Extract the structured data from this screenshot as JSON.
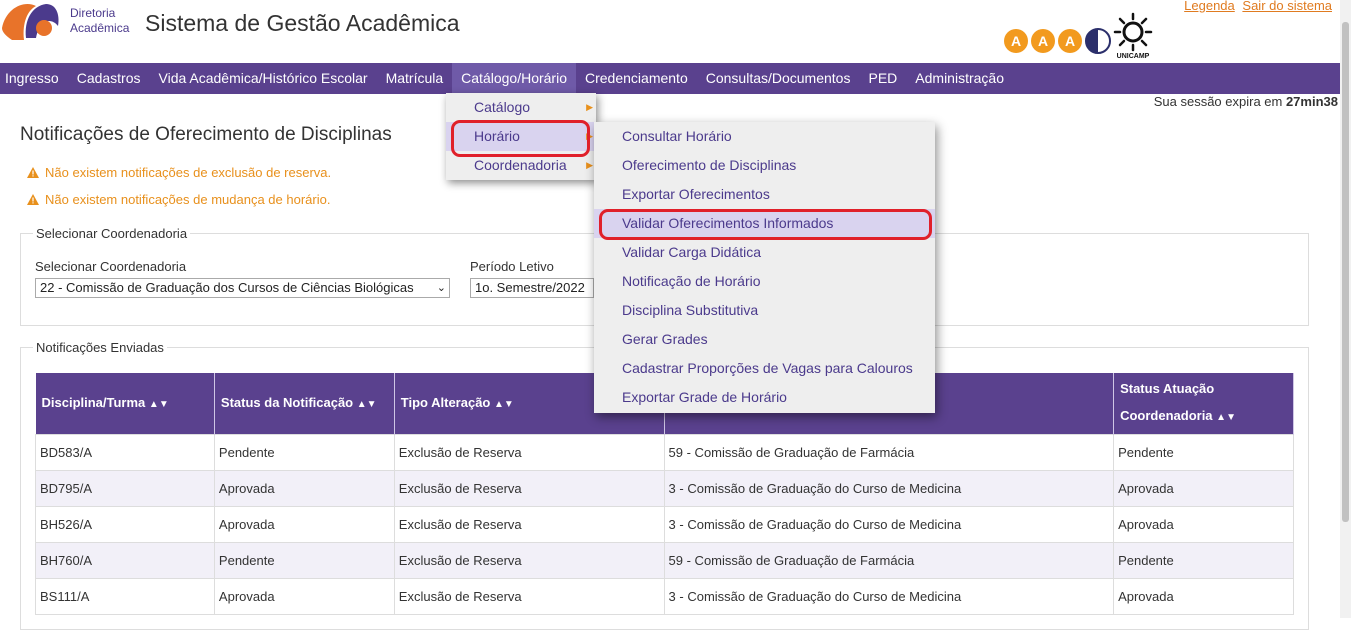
{
  "header": {
    "dir_line1": "Diretoria",
    "dir_line2": "Acadêmica",
    "title": "Sistema de Gestão Acadêmica",
    "legend_link": "Legenda",
    "logout_link": "Sair do sistema",
    "contrast_buttons": [
      "A",
      "A",
      "A"
    ],
    "unicamp_label": "UNICAMP"
  },
  "nav": {
    "items": [
      "Ingresso",
      "Cadastros",
      "Vida Acadêmica/Histórico Escolar",
      "Matrícula",
      "Catálogo/Horário",
      "Credenciamento",
      "Consultas/Documentos",
      "PED",
      "Administração"
    ],
    "active_index": 4
  },
  "session": {
    "text": "Sua sessão expira em ",
    "time": "27min38"
  },
  "page": {
    "title": "Notificações de Oferecimento de Disciplinas",
    "warnings": [
      "Não existem notificações de exclusão de reserva.",
      "Não existem notificações de mudança de horário."
    ]
  },
  "filters": {
    "legend": "Selecionar Coordenadoria",
    "coord_label": "Selecionar Coordenadoria",
    "coord_value": "22 - Comissão de Graduação dos Cursos de Ciências Biológicas",
    "period_label": "Período Letivo",
    "period_value": "1o. Semestre/2022"
  },
  "notifications": {
    "legend": "Notificações Enviadas",
    "headers": [
      "Disciplina/Turma",
      "Status da Notificação",
      "Tipo Alteração",
      "",
      "Status Atuação Coordenadoria"
    ],
    "rows": [
      [
        "BD583/A",
        "Pendente",
        "Exclusão de Reserva",
        "59 - Comissão de Graduação de Farmácia",
        "Pendente"
      ],
      [
        "BD795/A",
        "Aprovada",
        "Exclusão de Reserva",
        "3 - Comissão de Graduação do Curso de Medicina",
        "Aprovada"
      ],
      [
        "BH526/A",
        "Aprovada",
        "Exclusão de Reserva",
        "3 - Comissão de Graduação do Curso de Medicina",
        "Aprovada"
      ],
      [
        "BH760/A",
        "Pendente",
        "Exclusão de Reserva",
        "59 - Comissão de Graduação de Farmácia",
        "Pendente"
      ],
      [
        "BS111/A",
        "Aprovada",
        "Exclusão de Reserva",
        "3 - Comissão de Graduação do Curso de Medicina",
        "Aprovada"
      ]
    ]
  },
  "menu_catalogo": {
    "items": [
      "Catálogo",
      "Horário",
      "Coordenadoria"
    ],
    "highlighted_index": 1
  },
  "menu_horario": {
    "items": [
      "Consultar Horário",
      "Oferecimento de Disciplinas",
      "Exportar Oferecimentos",
      "Validar Oferecimentos Informados",
      "Validar Carga Didática",
      "Notificação de Horário",
      "Disciplina Substitutiva",
      "Gerar Grades",
      "Cadastrar Proporções de Vagas para Calouros",
      "Exportar Grade de Horário"
    ],
    "highlighted_index": 3
  },
  "colors": {
    "nav_bg": "#5a418e",
    "accent_orange": "#e8901c",
    "highlight_ring": "#e0202a"
  }
}
